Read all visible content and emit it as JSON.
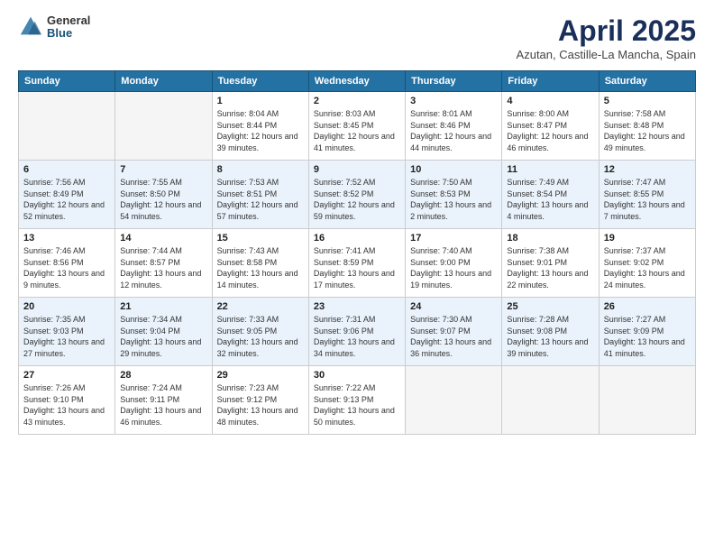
{
  "header": {
    "logo_general": "General",
    "logo_blue": "Blue",
    "month_title": "April 2025",
    "location": "Azutan, Castille-La Mancha, Spain"
  },
  "weekdays": [
    "Sunday",
    "Monday",
    "Tuesday",
    "Wednesday",
    "Thursday",
    "Friday",
    "Saturday"
  ],
  "weeks": [
    [
      {
        "day": "",
        "sunrise": "",
        "sunset": "",
        "daylight": ""
      },
      {
        "day": "",
        "sunrise": "",
        "sunset": "",
        "daylight": ""
      },
      {
        "day": "1",
        "sunrise": "Sunrise: 8:04 AM",
        "sunset": "Sunset: 8:44 PM",
        "daylight": "Daylight: 12 hours and 39 minutes."
      },
      {
        "day": "2",
        "sunrise": "Sunrise: 8:03 AM",
        "sunset": "Sunset: 8:45 PM",
        "daylight": "Daylight: 12 hours and 41 minutes."
      },
      {
        "day": "3",
        "sunrise": "Sunrise: 8:01 AM",
        "sunset": "Sunset: 8:46 PM",
        "daylight": "Daylight: 12 hours and 44 minutes."
      },
      {
        "day": "4",
        "sunrise": "Sunrise: 8:00 AM",
        "sunset": "Sunset: 8:47 PM",
        "daylight": "Daylight: 12 hours and 46 minutes."
      },
      {
        "day": "5",
        "sunrise": "Sunrise: 7:58 AM",
        "sunset": "Sunset: 8:48 PM",
        "daylight": "Daylight: 12 hours and 49 minutes."
      }
    ],
    [
      {
        "day": "6",
        "sunrise": "Sunrise: 7:56 AM",
        "sunset": "Sunset: 8:49 PM",
        "daylight": "Daylight: 12 hours and 52 minutes."
      },
      {
        "day": "7",
        "sunrise": "Sunrise: 7:55 AM",
        "sunset": "Sunset: 8:50 PM",
        "daylight": "Daylight: 12 hours and 54 minutes."
      },
      {
        "day": "8",
        "sunrise": "Sunrise: 7:53 AM",
        "sunset": "Sunset: 8:51 PM",
        "daylight": "Daylight: 12 hours and 57 minutes."
      },
      {
        "day": "9",
        "sunrise": "Sunrise: 7:52 AM",
        "sunset": "Sunset: 8:52 PM",
        "daylight": "Daylight: 12 hours and 59 minutes."
      },
      {
        "day": "10",
        "sunrise": "Sunrise: 7:50 AM",
        "sunset": "Sunset: 8:53 PM",
        "daylight": "Daylight: 13 hours and 2 minutes."
      },
      {
        "day": "11",
        "sunrise": "Sunrise: 7:49 AM",
        "sunset": "Sunset: 8:54 PM",
        "daylight": "Daylight: 13 hours and 4 minutes."
      },
      {
        "day": "12",
        "sunrise": "Sunrise: 7:47 AM",
        "sunset": "Sunset: 8:55 PM",
        "daylight": "Daylight: 13 hours and 7 minutes."
      }
    ],
    [
      {
        "day": "13",
        "sunrise": "Sunrise: 7:46 AM",
        "sunset": "Sunset: 8:56 PM",
        "daylight": "Daylight: 13 hours and 9 minutes."
      },
      {
        "day": "14",
        "sunrise": "Sunrise: 7:44 AM",
        "sunset": "Sunset: 8:57 PM",
        "daylight": "Daylight: 13 hours and 12 minutes."
      },
      {
        "day": "15",
        "sunrise": "Sunrise: 7:43 AM",
        "sunset": "Sunset: 8:58 PM",
        "daylight": "Daylight: 13 hours and 14 minutes."
      },
      {
        "day": "16",
        "sunrise": "Sunrise: 7:41 AM",
        "sunset": "Sunset: 8:59 PM",
        "daylight": "Daylight: 13 hours and 17 minutes."
      },
      {
        "day": "17",
        "sunrise": "Sunrise: 7:40 AM",
        "sunset": "Sunset: 9:00 PM",
        "daylight": "Daylight: 13 hours and 19 minutes."
      },
      {
        "day": "18",
        "sunrise": "Sunrise: 7:38 AM",
        "sunset": "Sunset: 9:01 PM",
        "daylight": "Daylight: 13 hours and 22 minutes."
      },
      {
        "day": "19",
        "sunrise": "Sunrise: 7:37 AM",
        "sunset": "Sunset: 9:02 PM",
        "daylight": "Daylight: 13 hours and 24 minutes."
      }
    ],
    [
      {
        "day": "20",
        "sunrise": "Sunrise: 7:35 AM",
        "sunset": "Sunset: 9:03 PM",
        "daylight": "Daylight: 13 hours and 27 minutes."
      },
      {
        "day": "21",
        "sunrise": "Sunrise: 7:34 AM",
        "sunset": "Sunset: 9:04 PM",
        "daylight": "Daylight: 13 hours and 29 minutes."
      },
      {
        "day": "22",
        "sunrise": "Sunrise: 7:33 AM",
        "sunset": "Sunset: 9:05 PM",
        "daylight": "Daylight: 13 hours and 32 minutes."
      },
      {
        "day": "23",
        "sunrise": "Sunrise: 7:31 AM",
        "sunset": "Sunset: 9:06 PM",
        "daylight": "Daylight: 13 hours and 34 minutes."
      },
      {
        "day": "24",
        "sunrise": "Sunrise: 7:30 AM",
        "sunset": "Sunset: 9:07 PM",
        "daylight": "Daylight: 13 hours and 36 minutes."
      },
      {
        "day": "25",
        "sunrise": "Sunrise: 7:28 AM",
        "sunset": "Sunset: 9:08 PM",
        "daylight": "Daylight: 13 hours and 39 minutes."
      },
      {
        "day": "26",
        "sunrise": "Sunrise: 7:27 AM",
        "sunset": "Sunset: 9:09 PM",
        "daylight": "Daylight: 13 hours and 41 minutes."
      }
    ],
    [
      {
        "day": "27",
        "sunrise": "Sunrise: 7:26 AM",
        "sunset": "Sunset: 9:10 PM",
        "daylight": "Daylight: 13 hours and 43 minutes."
      },
      {
        "day": "28",
        "sunrise": "Sunrise: 7:24 AM",
        "sunset": "Sunset: 9:11 PM",
        "daylight": "Daylight: 13 hours and 46 minutes."
      },
      {
        "day": "29",
        "sunrise": "Sunrise: 7:23 AM",
        "sunset": "Sunset: 9:12 PM",
        "daylight": "Daylight: 13 hours and 48 minutes."
      },
      {
        "day": "30",
        "sunrise": "Sunrise: 7:22 AM",
        "sunset": "Sunset: 9:13 PM",
        "daylight": "Daylight: 13 hours and 50 minutes."
      },
      {
        "day": "",
        "sunrise": "",
        "sunset": "",
        "daylight": ""
      },
      {
        "day": "",
        "sunrise": "",
        "sunset": "",
        "daylight": ""
      },
      {
        "day": "",
        "sunrise": "",
        "sunset": "",
        "daylight": ""
      }
    ]
  ]
}
